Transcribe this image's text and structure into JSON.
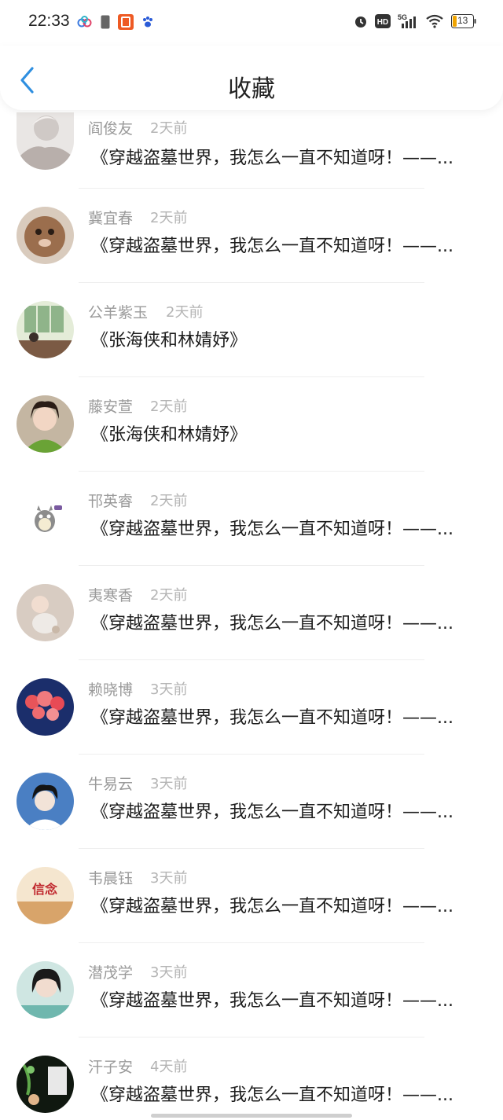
{
  "status": {
    "time": "22:33",
    "battery": "13",
    "network": "5G"
  },
  "header": {
    "title": "收藏"
  },
  "items": [
    {
      "name": "阎俊友",
      "time": "2天前",
      "title": "《穿越盗墓世界，我怎么一直不知道呀！——..."
    },
    {
      "name": "冀宜春",
      "time": "2天前",
      "title": "《穿越盗墓世界，我怎么一直不知道呀！——..."
    },
    {
      "name": "公羊紫玉",
      "time": "2天前",
      "title": "《张海侠和林婧妤》"
    },
    {
      "name": "藤安萱",
      "time": "2天前",
      "title": "《张海侠和林婧妤》"
    },
    {
      "name": "邗英睿",
      "time": "2天前",
      "title": "《穿越盗墓世界，我怎么一直不知道呀！——..."
    },
    {
      "name": "夷寒香",
      "time": "2天前",
      "title": "《穿越盗墓世界，我怎么一直不知道呀！——..."
    },
    {
      "name": "赖晓博",
      "time": "3天前",
      "title": "《穿越盗墓世界，我怎么一直不知道呀！——..."
    },
    {
      "name": "牛易云",
      "time": "3天前",
      "title": "《穿越盗墓世界，我怎么一直不知道呀！——..."
    },
    {
      "name": "韦晨钰",
      "time": "3天前",
      "title": "《穿越盗墓世界，我怎么一直不知道呀！——...",
      "avatar_text": "信念"
    },
    {
      "name": "潜茂学",
      "time": "3天前",
      "title": "《穿越盗墓世界，我怎么一直不知道呀！——..."
    },
    {
      "name": "汗子安",
      "time": "4天前",
      "title": "《穿越盗墓世界，我怎么一直不知道呀！——..."
    }
  ],
  "colors": {
    "accent": "#2f8fe0",
    "text_primary": "#1d1d1d",
    "text_secondary": "#9a9a9a"
  }
}
